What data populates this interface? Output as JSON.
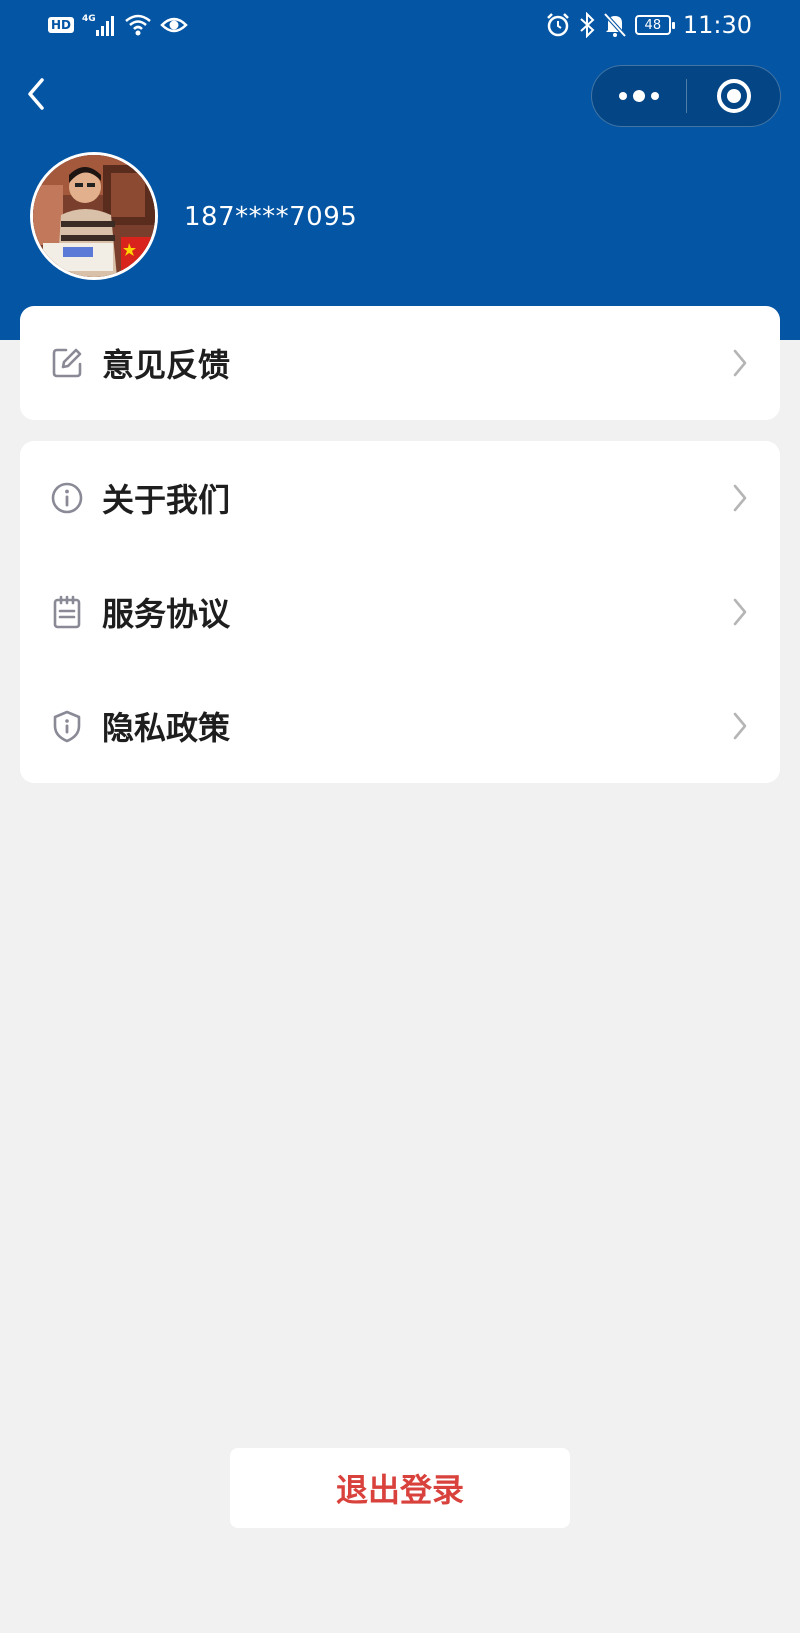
{
  "status_bar": {
    "left_icons": [
      "hd-icon",
      "4g-signal-icon",
      "wifi-icon",
      "eye-icon"
    ],
    "hd_label": "HD",
    "network_label": "4G",
    "right_icons": [
      "alarm-icon",
      "bluetooth-icon",
      "mute-bell-icon",
      "battery-icon"
    ],
    "battery_level": "48",
    "time": "11:30"
  },
  "nav": {
    "back_icon": "chevron-left-icon",
    "more_icon": "more-dots-icon",
    "close_icon": "target-circle-icon"
  },
  "profile": {
    "phone": "187****7095"
  },
  "menu_group_1": [
    {
      "label": "意见反馈",
      "icon": "edit-icon"
    }
  ],
  "menu_group_2": [
    {
      "label": "关于我们",
      "icon": "info-icon"
    },
    {
      "label": "服务协议",
      "icon": "document-icon"
    },
    {
      "label": "隐私政策",
      "icon": "shield-icon"
    }
  ],
  "logout_label": "退出登录",
  "colors": {
    "header_bg": "#0455a3",
    "page_bg": "#f1f1f1",
    "logout_text": "#d9423c",
    "icon_gray": "#8a8a96",
    "chevron_gray": "#b5b5b5"
  }
}
